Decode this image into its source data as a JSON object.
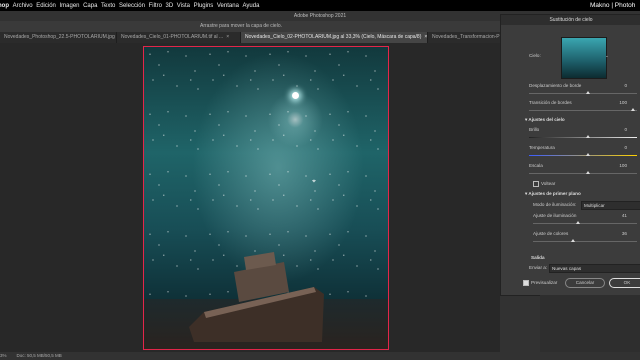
{
  "menu": {
    "app": "hop",
    "items": [
      "Archivo",
      "Edición",
      "Imagen",
      "Capa",
      "Texto",
      "Selección",
      "Filtro",
      "3D",
      "Vista",
      "Plugins",
      "Ventana",
      "Ayuda"
    ]
  },
  "watermark": "Makno | Photoh",
  "title": "Adobe Photoshop 2021",
  "options_hint": "Arrastre para mover la capa de cielo.",
  "tabs": [
    {
      "label": "Novedades_Photoshop_22.5-PHOTOLARIUM.jpg",
      "close": "×"
    },
    {
      "label": "Novedades_Cielo_01-PHOTOLARIUM.tif al ...",
      "close": "×"
    },
    {
      "label": "Novedades_Cielo_02-PHOTOLARIUM.jpg al 33,3% (Cielo, Máscara de capa/8)",
      "close": "×"
    },
    {
      "label": "Novedades_Transformacion-P",
      "close": ""
    }
  ],
  "dialog": {
    "title": "Sustitución de cielo",
    "sky_label": "Cielo:",
    "shift_edge_label": "Desplazamiento de borde",
    "shift_edge_value": "0",
    "fade_edge_label": "Transición de bordes",
    "fade_edge_value": "100",
    "sky_adjust_section": "Ajustes del cielo",
    "brightness_label": "Brillo",
    "brightness_value": "0",
    "temperature_label": "Temperatura",
    "temperature_value": "0",
    "scale_label": "Escala",
    "scale_value": "100",
    "flip_label": "Voltear",
    "foreground_section": "Ajustes de primer plano",
    "lighting_mode_label": "Modo de iluminación:",
    "lighting_mode_value": "Multiplicar",
    "lighting_adjust_label": "Ajuste de iluminación",
    "lighting_adjust_value": "41",
    "color_adjust_label": "Ajuste de colores",
    "color_adjust_value": "36",
    "output_section": "Salida",
    "output_to_label": "Enviar a:",
    "output_to_value": "Nuevas capas",
    "preview_label": "Previsualizar",
    "cancel_label": "Cancelar",
    "ok_label": "OK"
  },
  "slider_levels": {
    "shift_edge": 0.5,
    "fade_edge": 1.0,
    "brightness": 0.5,
    "temperature": 0.5,
    "scale": 0.5,
    "lighting_adjust": 0.41,
    "color_adjust": 0.36
  },
  "status": {
    "zoom": "3%",
    "doc": "Doc: 50,5 MB/50,5 MB"
  },
  "icons": {
    "move": "move-icon",
    "brush": "sky-brush-icon",
    "hand": "hand-icon",
    "zoom": "zoom-icon"
  },
  "colors": {
    "selection_border": "#e3264a",
    "ok_button": "#dddddd"
  }
}
